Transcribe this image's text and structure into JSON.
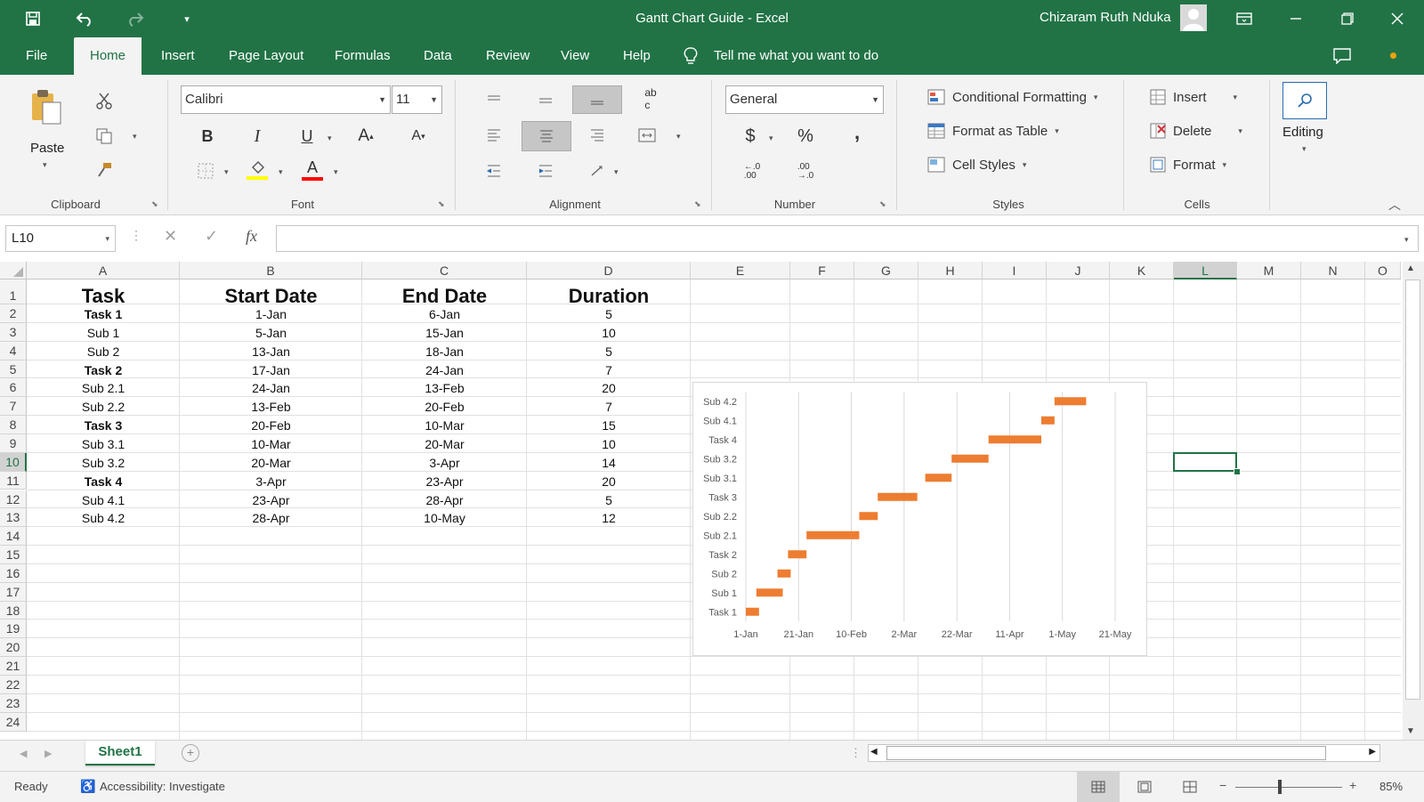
{
  "title_bar": {
    "title": "Gantt Chart Guide  -  Excel",
    "user_name": "Chizaram Ruth Nduka"
  },
  "tabs": [
    "File",
    "Home",
    "Insert",
    "Page Layout",
    "Formulas",
    "Data",
    "Review",
    "View",
    "Help"
  ],
  "tell_me": "Tell me what you want to do",
  "ribbon": {
    "clipboard": {
      "paste": "Paste",
      "label": "Clipboard"
    },
    "font": {
      "name": "Calibri",
      "size": "11",
      "label": "Font",
      "fill_color": "#ffff00",
      "font_color": "#ff0000"
    },
    "alignment": {
      "label": "Alignment"
    },
    "number": {
      "format": "General",
      "currency": "$",
      "percent": "%",
      "comma": ",",
      "label": "Number"
    },
    "styles": {
      "conditional": "Conditional Formatting",
      "format_table": "Format as Table",
      "cell_styles": "Cell Styles",
      "label": "Styles"
    },
    "cells": {
      "insert": "Insert",
      "delete": "Delete",
      "format": "Format",
      "label": "Cells"
    },
    "editing": {
      "label": "Editing"
    }
  },
  "formula_bar": {
    "name_box": "L10",
    "fx": "fx",
    "formula": ""
  },
  "columns": [
    "A",
    "B",
    "C",
    "D",
    "E",
    "F",
    "G",
    "H",
    "I",
    "J",
    "K",
    "L",
    "M",
    "N",
    "O"
  ],
  "rows": [
    "1",
    "2",
    "3",
    "4",
    "5",
    "6",
    "7",
    "8",
    "9",
    "10",
    "11",
    "12",
    "13",
    "14",
    "15",
    "16",
    "17",
    "18",
    "19",
    "20",
    "21",
    "22",
    "23",
    "24"
  ],
  "table": {
    "headers": [
      "Task",
      "Start Date",
      "End Date",
      "Duration"
    ],
    "rows": [
      [
        "Task 1",
        "1-Jan",
        "6-Jan",
        "5"
      ],
      [
        "Sub 1",
        "5-Jan",
        "15-Jan",
        "10"
      ],
      [
        "Sub 2",
        "13-Jan",
        "18-Jan",
        "5"
      ],
      [
        "Task 2",
        "17-Jan",
        "24-Jan",
        "7"
      ],
      [
        "Sub 2.1",
        "24-Jan",
        "13-Feb",
        "20"
      ],
      [
        "Sub 2.2",
        "13-Feb",
        "20-Feb",
        "7"
      ],
      [
        "Task 3",
        "20-Feb",
        "10-Mar",
        "15"
      ],
      [
        "Sub 3.1",
        "10-Mar",
        "20-Mar",
        "10"
      ],
      [
        "Sub 3.2",
        "20-Mar",
        "3-Apr",
        "14"
      ],
      [
        "Task 4",
        "3-Apr",
        "23-Apr",
        "20"
      ],
      [
        "Sub 4.1",
        "23-Apr",
        "28-Apr",
        "5"
      ],
      [
        "Sub 4.2",
        "28-Apr",
        "10-May",
        "12"
      ]
    ],
    "bold_rows": [
      0,
      3,
      6,
      9
    ]
  },
  "chart_data": {
    "type": "bar",
    "orientation": "horizontal-gantt",
    "categories": [
      "Task 1",
      "Sub 1",
      "Sub 2",
      "Task 2",
      "Sub 2.1",
      "Sub 2.2",
      "Task 3",
      "Sub 3.1",
      "Sub 3.2",
      "Task 4",
      "Sub 4.1",
      "Sub 4.2"
    ],
    "series": [
      {
        "start": [
          "1-Jan",
          "5-Jan",
          "13-Jan",
          "17-Jan",
          "24-Jan",
          "13-Feb",
          "20-Feb",
          "10-Mar",
          "20-Mar",
          "3-Apr",
          "23-Apr",
          "28-Apr"
        ],
        "color": "#ed7d31"
      },
      {
        "values": [
          5,
          10,
          5,
          7,
          20,
          7,
          15,
          10,
          14,
          20,
          5,
          12
        ],
        "color": "#ed7d31"
      }
    ],
    "x_tick_labels": [
      "1-Jan",
      "21-Jan",
      "10-Feb",
      "2-Mar",
      "22-Mar",
      "11-Apr",
      "1-May",
      "21-May"
    ],
    "xlim": [
      "1-Jan",
      "21-May"
    ],
    "title": "",
    "xlabel": "",
    "ylabel": "",
    "grid": "vertical",
    "legend": "none"
  },
  "sheet_tabs": [
    "Sheet1"
  ],
  "status": {
    "ready": "Ready",
    "accessibility": "Accessibility: Investigate",
    "zoom": "85%",
    "zoom_fraction": 0.85
  }
}
